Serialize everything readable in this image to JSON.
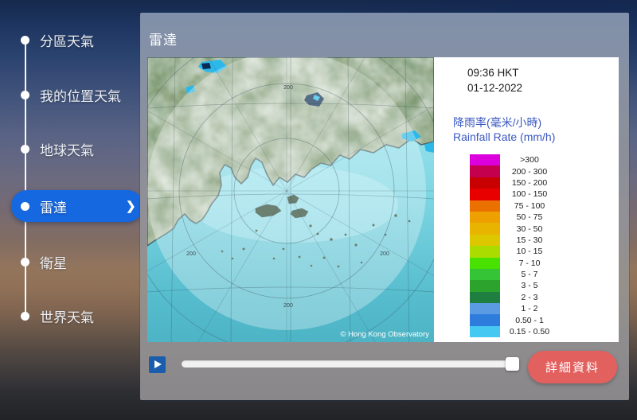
{
  "sidebar": {
    "items": [
      {
        "key": "district-weather",
        "label": "分區天氣",
        "active": false
      },
      {
        "key": "my-location-weather",
        "label": "我的位置天氣",
        "active": false
      },
      {
        "key": "earth-weather",
        "label": "地球天氣",
        "active": false
      },
      {
        "key": "radar",
        "label": "雷達",
        "active": true
      },
      {
        "key": "satellite",
        "label": "衛星",
        "active": false
      },
      {
        "key": "world-weather",
        "label": "世界天氣",
        "active": false
      }
    ],
    "active_chevron": "❯"
  },
  "main": {
    "title": "雷達"
  },
  "radar": {
    "timestamp_time": "09:36 HKT",
    "timestamp_date": "01-12-2022",
    "legend_title_zh": "降雨率(毫米/小時)",
    "legend_title_en": "Rainfall Rate (mm/h)",
    "ring_label": "200",
    "copyright": "© Hong Kong Observatory",
    "legend": [
      {
        "range": ">300",
        "color": "#dc00dc"
      },
      {
        "range": "200 - 300",
        "color": "#c4004e"
      },
      {
        "range": "150 - 200",
        "color": "#c80000"
      },
      {
        "range": "100 - 150",
        "color": "#e80000"
      },
      {
        "range": "75 - 100",
        "color": "#ea7000"
      },
      {
        "range": "50 - 75",
        "color": "#eea000"
      },
      {
        "range": "30 - 50",
        "color": "#e8b400"
      },
      {
        "range": "15 - 30",
        "color": "#ddc700"
      },
      {
        "range": "10 - 15",
        "color": "#abdc00"
      },
      {
        "range": "7 - 10",
        "color": "#48e102"
      },
      {
        "range": "5 - 7",
        "color": "#35c435"
      },
      {
        "range": "3 - 5",
        "color": "#2ca32c"
      },
      {
        "range": "2 - 3",
        "color": "#1f7f41"
      },
      {
        "range": "1 - 2",
        "color": "#5b9be4"
      },
      {
        "range": "0.50 - 1",
        "color": "#2e7ddd"
      },
      {
        "range": "0.15 - 0.50",
        "color": "#45c8f2"
      }
    ]
  },
  "controls": {
    "play_icon": "play",
    "detail_button_label": "詳細資料"
  },
  "colors": {
    "accent_blue": "#1568e0",
    "button_red": "#e2615f",
    "play_button_blue": "#1a5dad",
    "legend_heading_blue": "#3a57c0"
  }
}
